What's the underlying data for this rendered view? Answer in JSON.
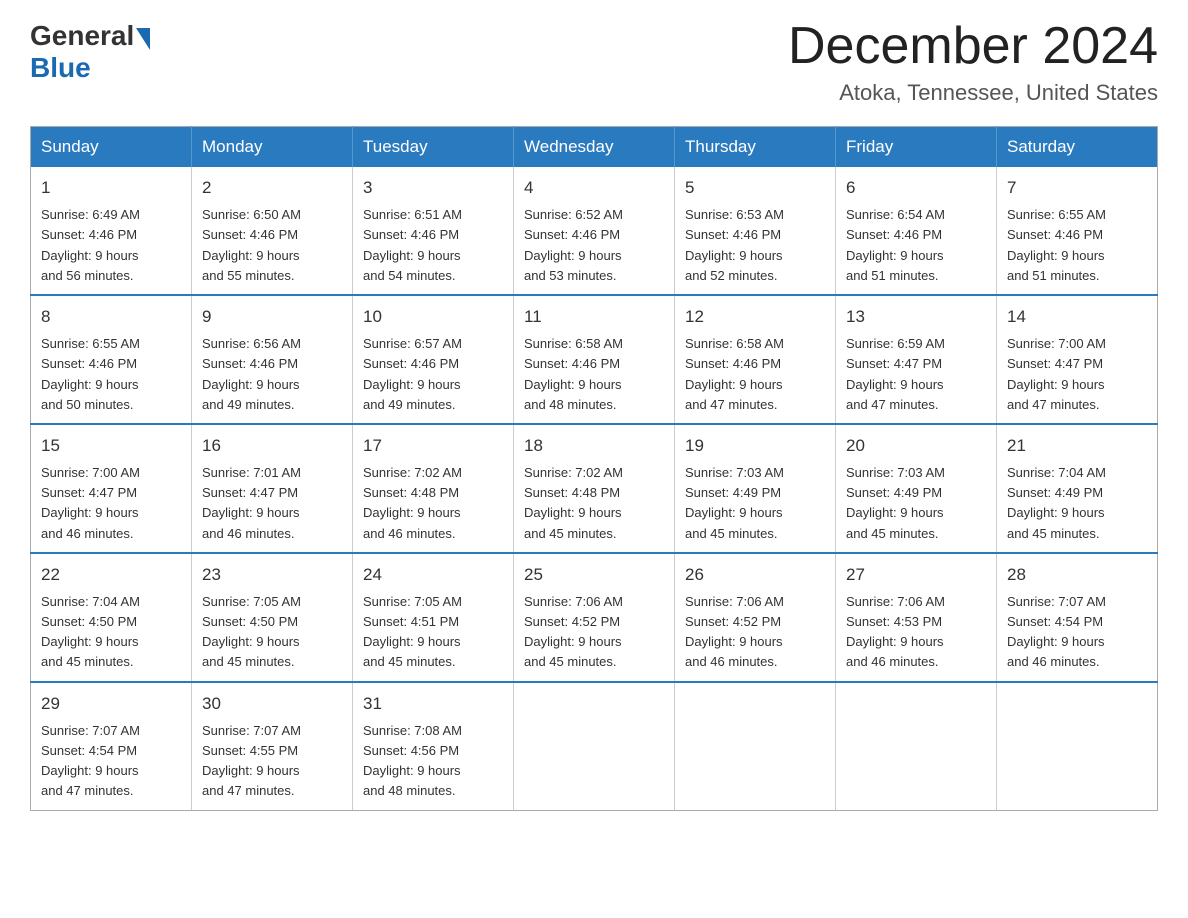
{
  "header": {
    "logo_general": "General",
    "logo_blue": "Blue",
    "month_title": "December 2024",
    "location": "Atoka, Tennessee, United States"
  },
  "days_of_week": [
    "Sunday",
    "Monday",
    "Tuesday",
    "Wednesday",
    "Thursday",
    "Friday",
    "Saturday"
  ],
  "weeks": [
    [
      {
        "day": "1",
        "sunrise": "6:49 AM",
        "sunset": "4:46 PM",
        "daylight": "9 hours and 56 minutes."
      },
      {
        "day": "2",
        "sunrise": "6:50 AM",
        "sunset": "4:46 PM",
        "daylight": "9 hours and 55 minutes."
      },
      {
        "day": "3",
        "sunrise": "6:51 AM",
        "sunset": "4:46 PM",
        "daylight": "9 hours and 54 minutes."
      },
      {
        "day": "4",
        "sunrise": "6:52 AM",
        "sunset": "4:46 PM",
        "daylight": "9 hours and 53 minutes."
      },
      {
        "day": "5",
        "sunrise": "6:53 AM",
        "sunset": "4:46 PM",
        "daylight": "9 hours and 52 minutes."
      },
      {
        "day": "6",
        "sunrise": "6:54 AM",
        "sunset": "4:46 PM",
        "daylight": "9 hours and 51 minutes."
      },
      {
        "day": "7",
        "sunrise": "6:55 AM",
        "sunset": "4:46 PM",
        "daylight": "9 hours and 51 minutes."
      }
    ],
    [
      {
        "day": "8",
        "sunrise": "6:55 AM",
        "sunset": "4:46 PM",
        "daylight": "9 hours and 50 minutes."
      },
      {
        "day": "9",
        "sunrise": "6:56 AM",
        "sunset": "4:46 PM",
        "daylight": "9 hours and 49 minutes."
      },
      {
        "day": "10",
        "sunrise": "6:57 AM",
        "sunset": "4:46 PM",
        "daylight": "9 hours and 49 minutes."
      },
      {
        "day": "11",
        "sunrise": "6:58 AM",
        "sunset": "4:46 PM",
        "daylight": "9 hours and 48 minutes."
      },
      {
        "day": "12",
        "sunrise": "6:58 AM",
        "sunset": "4:46 PM",
        "daylight": "9 hours and 47 minutes."
      },
      {
        "day": "13",
        "sunrise": "6:59 AM",
        "sunset": "4:47 PM",
        "daylight": "9 hours and 47 minutes."
      },
      {
        "day": "14",
        "sunrise": "7:00 AM",
        "sunset": "4:47 PM",
        "daylight": "9 hours and 47 minutes."
      }
    ],
    [
      {
        "day": "15",
        "sunrise": "7:00 AM",
        "sunset": "4:47 PM",
        "daylight": "9 hours and 46 minutes."
      },
      {
        "day": "16",
        "sunrise": "7:01 AM",
        "sunset": "4:47 PM",
        "daylight": "9 hours and 46 minutes."
      },
      {
        "day": "17",
        "sunrise": "7:02 AM",
        "sunset": "4:48 PM",
        "daylight": "9 hours and 46 minutes."
      },
      {
        "day": "18",
        "sunrise": "7:02 AM",
        "sunset": "4:48 PM",
        "daylight": "9 hours and 45 minutes."
      },
      {
        "day": "19",
        "sunrise": "7:03 AM",
        "sunset": "4:49 PM",
        "daylight": "9 hours and 45 minutes."
      },
      {
        "day": "20",
        "sunrise": "7:03 AM",
        "sunset": "4:49 PM",
        "daylight": "9 hours and 45 minutes."
      },
      {
        "day": "21",
        "sunrise": "7:04 AM",
        "sunset": "4:49 PM",
        "daylight": "9 hours and 45 minutes."
      }
    ],
    [
      {
        "day": "22",
        "sunrise": "7:04 AM",
        "sunset": "4:50 PM",
        "daylight": "9 hours and 45 minutes."
      },
      {
        "day": "23",
        "sunrise": "7:05 AM",
        "sunset": "4:50 PM",
        "daylight": "9 hours and 45 minutes."
      },
      {
        "day": "24",
        "sunrise": "7:05 AM",
        "sunset": "4:51 PM",
        "daylight": "9 hours and 45 minutes."
      },
      {
        "day": "25",
        "sunrise": "7:06 AM",
        "sunset": "4:52 PM",
        "daylight": "9 hours and 45 minutes."
      },
      {
        "day": "26",
        "sunrise": "7:06 AM",
        "sunset": "4:52 PM",
        "daylight": "9 hours and 46 minutes."
      },
      {
        "day": "27",
        "sunrise": "7:06 AM",
        "sunset": "4:53 PM",
        "daylight": "9 hours and 46 minutes."
      },
      {
        "day": "28",
        "sunrise": "7:07 AM",
        "sunset": "4:54 PM",
        "daylight": "9 hours and 46 minutes."
      }
    ],
    [
      {
        "day": "29",
        "sunrise": "7:07 AM",
        "sunset": "4:54 PM",
        "daylight": "9 hours and 47 minutes."
      },
      {
        "day": "30",
        "sunrise": "7:07 AM",
        "sunset": "4:55 PM",
        "daylight": "9 hours and 47 minutes."
      },
      {
        "day": "31",
        "sunrise": "7:08 AM",
        "sunset": "4:56 PM",
        "daylight": "9 hours and 48 minutes."
      },
      null,
      null,
      null,
      null
    ]
  ]
}
